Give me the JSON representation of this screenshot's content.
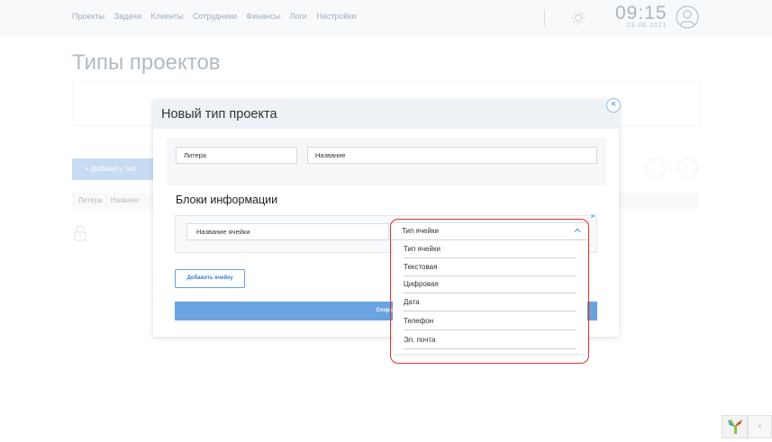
{
  "nav": {
    "items": [
      "Проекты",
      "Задачи",
      "Клиенты",
      "Сотрудники",
      "Финансы",
      "Логи",
      "Настройки"
    ]
  },
  "header": {
    "time": "09:15",
    "date": "23.06.2021"
  },
  "page": {
    "title": "Типы проектов",
    "add_button": "+  Добавить тип",
    "columns": [
      "Литера",
      "Названи"
    ]
  },
  "modal": {
    "title": "Новый тип проекта",
    "close": "×",
    "litera_placeholder": "Литера",
    "name_placeholder": "Название",
    "section_title": "Блоки информации",
    "cell_name_placeholder": "Название ячейки",
    "row_close": "×",
    "add_cell_button": "Добавить ячейку",
    "save_button": "Сохран"
  },
  "dropdown": {
    "selected": "Тип ячейки",
    "options": [
      "Тип ячейки",
      "Текстовая",
      "Цифровая",
      "Дата",
      "Телефон",
      "Эл. почта"
    ]
  },
  "debug_toolbar": {
    "toggle": "‹"
  },
  "colors": {
    "accent": "#6aa3e0",
    "highlight": "#d9342b"
  }
}
